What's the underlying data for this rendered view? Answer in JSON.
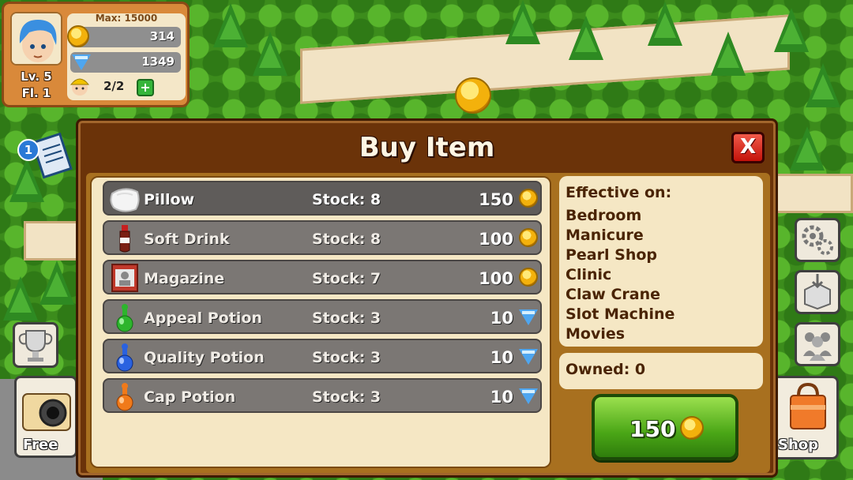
{
  "hud": {
    "max_label": "Max: 15000",
    "coins": "314",
    "gems": "1349",
    "workers": "2/2",
    "level": "Lv. 5",
    "floor": "Fl. 1",
    "add_worker_label": "+"
  },
  "notifications": {
    "count": "1"
  },
  "side_buttons": {
    "free_label": "Free",
    "shop_label": "Shop"
  },
  "dialog": {
    "title": "Buy Item",
    "close_label": "X",
    "items": [
      {
        "name": "Pillow",
        "stock": "Stock: 8",
        "price": "150",
        "currency": "coin",
        "icon": "pillow-icon"
      },
      {
        "name": "Soft Drink",
        "stock": "Stock: 8",
        "price": "100",
        "currency": "coin",
        "icon": "soda-bottle-icon"
      },
      {
        "name": "Magazine",
        "stock": "Stock: 7",
        "price": "100",
        "currency": "coin",
        "icon": "magazine-icon"
      },
      {
        "name": "Appeal Potion",
        "stock": "Stock: 3",
        "price": "10",
        "currency": "gem",
        "icon": "green-potion-icon"
      },
      {
        "name": "Quality Potion",
        "stock": "Stock: 3",
        "price": "10",
        "currency": "gem",
        "icon": "blue-potion-icon"
      },
      {
        "name": "Cap Potion",
        "stock": "Stock: 3",
        "price": "10",
        "currency": "gem",
        "icon": "orange-potion-icon"
      }
    ],
    "selected_index": 0,
    "effective_title": "Effective on:",
    "effective_on": [
      "Bedroom",
      "Manicure",
      "Pearl Shop",
      "Clinic",
      "Claw Crane",
      "Slot Machine",
      "Movies"
    ],
    "owned": "Owned: 0",
    "buy_price": "150"
  },
  "colors": {
    "dialog_brown": "#6b3309",
    "panel_cream": "#f5e7c4",
    "row_gray": "#7b7774",
    "buy_green": "#4aa616",
    "close_red": "#c4120a"
  }
}
